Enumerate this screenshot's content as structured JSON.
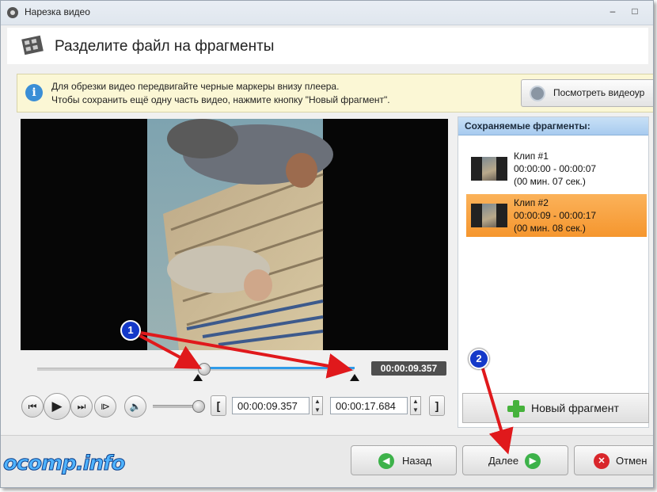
{
  "window": {
    "title": "Нарезка видео",
    "controls": [
      "–",
      "□"
    ]
  },
  "header": {
    "title": "Разделите файл на фрагменты"
  },
  "info": {
    "line1": "Для обрезки видео передвигайте черные маркеры внизу плеера.",
    "line2": "Чтобы сохранить ещё одну часть видео, нажмите кнопку \"Новый фрагмент\".",
    "howto_button": "Посмотреть видеоур"
  },
  "player": {
    "current_time": "00:00:09.357",
    "start_time": "00:00:09.357",
    "end_time": "00:00:17.684",
    "bracket_start": "[",
    "bracket_end": "]",
    "transport": {
      "to_start": "⏮",
      "play": "▶",
      "to_end": "⏭",
      "step": "⧐"
    },
    "volume_icon": "🔈",
    "volume_level": 1.0,
    "selection_start_fraction": 0.53,
    "selection_end_fraction": 1.0
  },
  "fragments": {
    "title": "Сохраняемые фрагменты:",
    "items": [
      {
        "name": "Клип #1",
        "range": "00:00:00 - 00:00:07",
        "duration": "(00 мин. 07 сек.)",
        "selected": false
      },
      {
        "name": "Клип #2",
        "range": "00:00:09 - 00:00:17",
        "duration": "(00 мин. 08 сек.)",
        "selected": true
      }
    ],
    "new_fragment_button": "Новый фрагмент"
  },
  "footer": {
    "back_button": "Назад",
    "next_button": "Далее",
    "cancel_button": "Отмен"
  },
  "annotations": {
    "badge1": "1",
    "badge2": "2"
  },
  "watermark": "ocomp.info",
  "colors": {
    "accent_blue": "#2f9be8",
    "selected_clip": "#f5962e",
    "arrow_red": "#e0191c",
    "badge_blue": "#1439c9"
  }
}
